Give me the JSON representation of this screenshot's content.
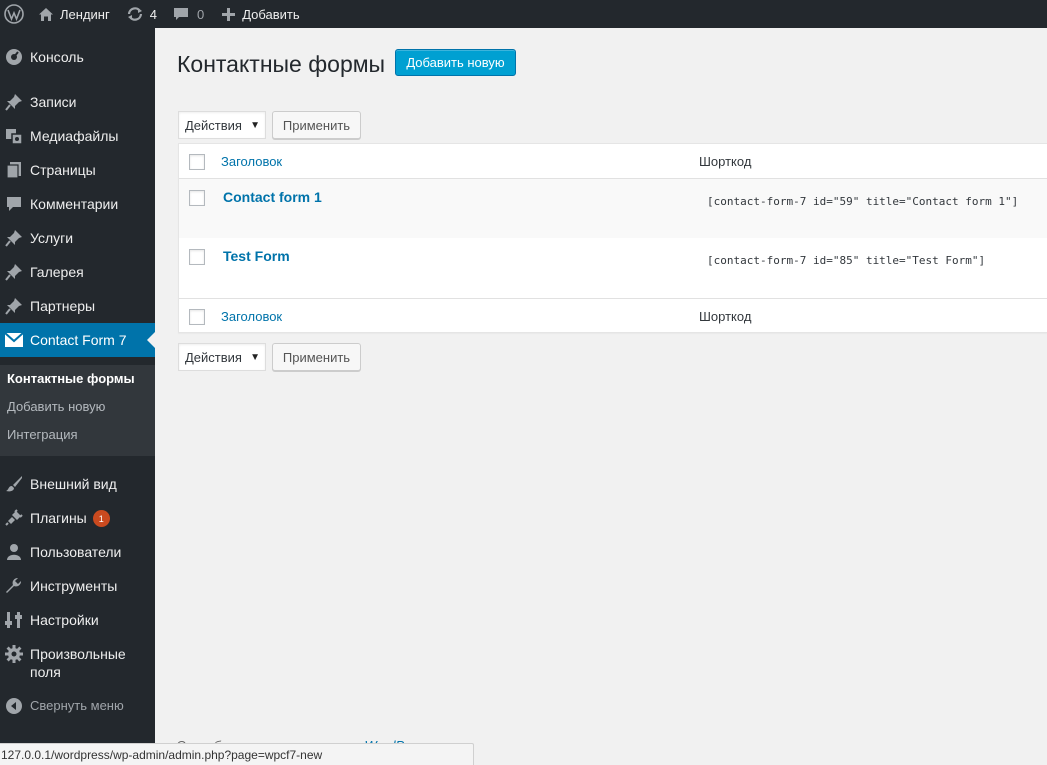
{
  "adminbar": {
    "site_name": "Лендинг",
    "updates_count": "4",
    "comments_count": "0",
    "new_label": "Добавить"
  },
  "sidebar": {
    "items": [
      {
        "label": "Консоль",
        "icon": "dashboard-icon"
      },
      {
        "label": "Записи",
        "icon": "pin-icon"
      },
      {
        "label": "Медиафайлы",
        "icon": "media-icon"
      },
      {
        "label": "Страницы",
        "icon": "pages-icon"
      },
      {
        "label": "Комментарии",
        "icon": "comment-icon"
      },
      {
        "label": "Услуги",
        "icon": "pin-icon"
      },
      {
        "label": "Галерея",
        "icon": "pin-icon"
      },
      {
        "label": "Партнеры",
        "icon": "pin-icon"
      },
      {
        "label": "Contact Form 7",
        "icon": "mail-icon"
      }
    ],
    "submenu": [
      {
        "label": "Контактные формы"
      },
      {
        "label": "Добавить новую"
      },
      {
        "label": "Интеграция"
      }
    ],
    "items2": [
      {
        "label": "Внешний вид",
        "icon": "brush-icon"
      },
      {
        "label": "Плагины",
        "icon": "plugin-icon",
        "badge": "1"
      },
      {
        "label": "Пользователи",
        "icon": "user-icon"
      },
      {
        "label": "Инструменты",
        "icon": "wrench-icon"
      },
      {
        "label": "Настройки",
        "icon": "settings-icon"
      },
      {
        "label": "Произвольные поля",
        "icon": "gear-icon"
      }
    ],
    "collapse_label": "Свернуть меню"
  },
  "main": {
    "title": "Контактные формы",
    "add_new": "Добавить новую",
    "bulk_actions": "Действия",
    "apply": "Применить",
    "columns": {
      "title": "Заголовок",
      "shortcode": "Шорткод"
    },
    "rows": [
      {
        "title": "Contact form 1",
        "shortcode": "[contact-form-7 id=\"59\" title=\"Contact form 1\"]"
      },
      {
        "title": "Test Form",
        "shortcode": "[contact-form-7 id=\"85\" title=\"Test Form\"]"
      }
    ]
  },
  "footer": {
    "text": "Спасибо вам за творчество с ",
    "link": "WordPress"
  },
  "statusbar": {
    "url": "127.0.0.1/wordpress/wp-admin/admin.php?page=wpcf7-new"
  },
  "colors": {
    "admin_bg": "#23282d",
    "accent": "#0073aa",
    "button_primary": "#00a0d2",
    "badge": "#ca4a1f"
  }
}
